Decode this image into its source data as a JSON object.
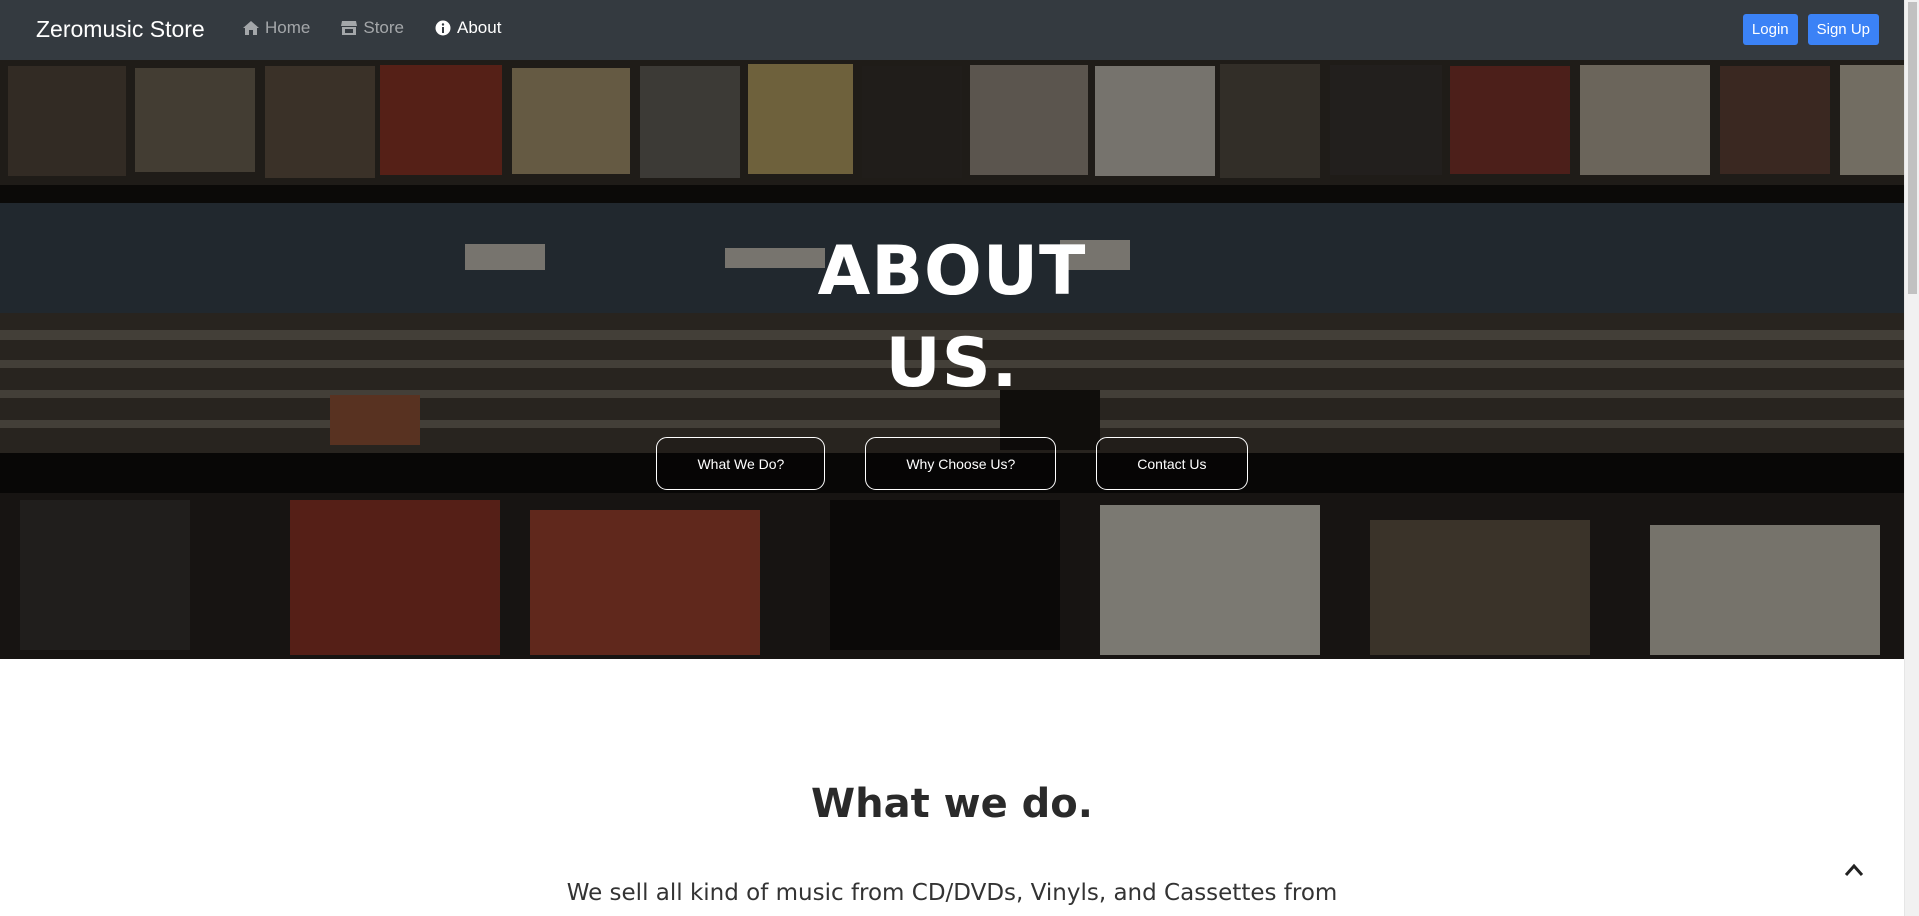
{
  "nav": {
    "brand": "Zeromusic Store",
    "links": [
      {
        "label": "Home",
        "icon": "home-icon"
      },
      {
        "label": "Store",
        "icon": "store-icon"
      },
      {
        "label": "About",
        "icon": "info-icon"
      }
    ],
    "login_label": "Login",
    "signup_label": "Sign Up"
  },
  "hero": {
    "title_line1": "ABOUT",
    "title_line2": "US.",
    "buttons": [
      "What We Do?",
      "Why Choose Us?",
      "Contact Us"
    ]
  },
  "section": {
    "title": "What we do.",
    "text": "We sell all kind of music from CD/DVDs, Vinyls, and Cassettes from various artists."
  },
  "colors": {
    "navbar": "#343a40",
    "primary": "#3b82f6"
  }
}
